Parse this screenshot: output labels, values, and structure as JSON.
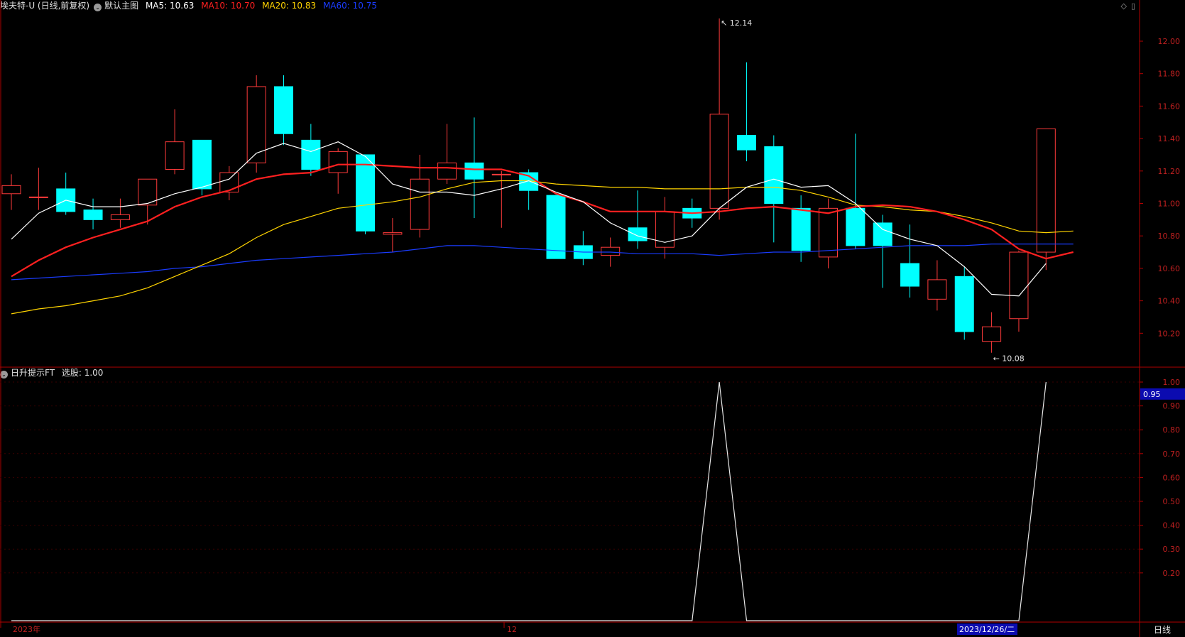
{
  "header": {
    "stock_title": "埃夫特-U (日线,前复权)",
    "main_indicator_label": "默认主图",
    "ma_readouts": [
      {
        "label": "MA5: 10.63",
        "color": "#ffffff"
      },
      {
        "label": "MA10: 10.70",
        "color": "#ff2020"
      },
      {
        "label": "MA20: 10.83",
        "color": "#ffd400"
      },
      {
        "label": "MA60: 10.75",
        "color": "#1a3cff"
      }
    ]
  },
  "indicator_header": {
    "name": "日升提示FT",
    "readout": "选股: 1.00"
  },
  "x_axis": {
    "labels": [
      "2023年",
      "12",
      "2023/12/26/二"
    ],
    "period_label": "日线"
  },
  "annotations": {
    "high_label": "12.14",
    "low_label": "10.08",
    "indicator_crosshair_value": "0.95"
  },
  "colors": {
    "up": "#ff3b3b",
    "down": "#00ffff",
    "axis": "#b00000",
    "ma5": "#ffffff",
    "ma10": "#ff2020",
    "ma20": "#ffd400",
    "ma60": "#1a3cff"
  },
  "chart_data": [
    {
      "type": "candlestick",
      "title": "埃夫特-U (日线,前复权)",
      "y_ticks": [
        10.2,
        10.4,
        10.6,
        10.8,
        11.0,
        11.2,
        11.4,
        11.6,
        11.8,
        12.0
      ],
      "ylim": [
        10.05,
        12.15
      ],
      "candles": [
        {
          "o": 11.06,
          "h": 11.18,
          "l": 10.96,
          "c": 11.11
        },
        {
          "o": 11.04,
          "h": 11.22,
          "l": 10.96,
          "c": 11.04
        },
        {
          "o": 11.09,
          "h": 11.19,
          "l": 10.93,
          "c": 10.95
        },
        {
          "o": 10.96,
          "h": 11.03,
          "l": 10.84,
          "c": 10.9
        },
        {
          "o": 10.9,
          "h": 11.03,
          "l": 10.85,
          "c": 10.93
        },
        {
          "o": 10.99,
          "h": 11.15,
          "l": 10.87,
          "c": 11.15
        },
        {
          "o": 11.21,
          "h": 11.58,
          "l": 11.18,
          "c": 11.38
        },
        {
          "o": 11.39,
          "h": 11.39,
          "l": 11.05,
          "c": 11.09
        },
        {
          "o": 11.07,
          "h": 11.23,
          "l": 11.02,
          "c": 11.19
        },
        {
          "o": 11.25,
          "h": 11.79,
          "l": 11.19,
          "c": 11.72
        },
        {
          "o": 11.72,
          "h": 11.79,
          "l": 11.36,
          "c": 11.43
        },
        {
          "o": 11.39,
          "h": 11.49,
          "l": 11.17,
          "c": 11.21
        },
        {
          "o": 11.19,
          "h": 11.34,
          "l": 11.06,
          "c": 11.32
        },
        {
          "o": 11.3,
          "h": 11.3,
          "l": 10.81,
          "c": 10.83
        },
        {
          "o": 10.81,
          "h": 10.91,
          "l": 10.7,
          "c": 10.82
        },
        {
          "o": 10.84,
          "h": 11.3,
          "l": 10.79,
          "c": 11.15
        },
        {
          "o": 11.15,
          "h": 11.49,
          "l": 11.12,
          "c": 11.25
        },
        {
          "o": 11.25,
          "h": 11.53,
          "l": 10.91,
          "c": 11.15
        },
        {
          "o": 11.18,
          "h": 11.2,
          "l": 10.85,
          "c": 11.18
        },
        {
          "o": 11.19,
          "h": 11.21,
          "l": 10.96,
          "c": 11.08
        },
        {
          "o": 11.05,
          "h": 11.05,
          "l": 10.66,
          "c": 10.66
        },
        {
          "o": 10.74,
          "h": 10.83,
          "l": 10.62,
          "c": 10.66
        },
        {
          "o": 10.68,
          "h": 10.79,
          "l": 10.61,
          "c": 10.73
        },
        {
          "o": 10.85,
          "h": 11.08,
          "l": 10.72,
          "c": 10.77
        },
        {
          "o": 10.73,
          "h": 11.04,
          "l": 10.66,
          "c": 10.95
        },
        {
          "o": 10.97,
          "h": 11.03,
          "l": 10.85,
          "c": 10.91
        },
        {
          "o": 10.97,
          "h": 12.14,
          "l": 10.9,
          "c": 11.55
        },
        {
          "o": 11.42,
          "h": 11.87,
          "l": 11.26,
          "c": 11.33
        },
        {
          "o": 11.35,
          "h": 11.42,
          "l": 10.76,
          "c": 11.0
        },
        {
          "o": 10.97,
          "h": 11.05,
          "l": 10.64,
          "c": 10.71
        },
        {
          "o": 10.67,
          "h": 11.03,
          "l": 10.6,
          "c": 10.97
        },
        {
          "o": 10.97,
          "h": 11.43,
          "l": 10.72,
          "c": 10.74
        },
        {
          "o": 10.88,
          "h": 10.93,
          "l": 10.48,
          "c": 10.74
        },
        {
          "o": 10.63,
          "h": 10.87,
          "l": 10.42,
          "c": 10.49
        },
        {
          "o": 10.41,
          "h": 10.65,
          "l": 10.34,
          "c": 10.53
        },
        {
          "o": 10.55,
          "h": 10.61,
          "l": 10.16,
          "c": 10.21
        },
        {
          "o": 10.15,
          "h": 10.33,
          "l": 10.08,
          "c": 10.24
        },
        {
          "o": 10.29,
          "h": 10.71,
          "l": 10.21,
          "c": 10.7
        },
        {
          "o": 10.7,
          "h": 11.46,
          "l": 10.59,
          "c": 11.46
        }
      ],
      "ma5": [
        10.78,
        10.94,
        11.02,
        10.98,
        10.98,
        11.0,
        11.06,
        11.1,
        11.15,
        11.31,
        11.37,
        11.32,
        11.38,
        11.29,
        11.12,
        11.07,
        11.07,
        11.05,
        11.09,
        11.14,
        11.07,
        11.01,
        10.88,
        10.8,
        10.76,
        10.8,
        10.97,
        11.1,
        11.15,
        11.1,
        11.11,
        11.0,
        10.84,
        10.78,
        10.74,
        10.61,
        10.44,
        10.43,
        10.63
      ],
      "ma10": [
        10.55,
        10.65,
        10.73,
        10.79,
        10.84,
        10.89,
        10.98,
        11.04,
        11.08,
        11.15,
        11.18,
        11.19,
        11.24,
        11.24,
        11.23,
        11.22,
        11.22,
        11.21,
        11.21,
        11.17,
        11.06,
        11.01,
        10.95,
        10.95,
        10.95,
        10.94,
        10.95,
        10.97,
        10.98,
        10.96,
        10.94,
        10.98,
        10.99,
        10.98,
        10.95,
        10.9,
        10.84,
        10.72,
        10.66,
        10.7
      ],
      "ma20": [
        10.32,
        10.35,
        10.37,
        10.4,
        10.43,
        10.48,
        10.55,
        10.62,
        10.69,
        10.79,
        10.87,
        10.92,
        10.97,
        10.99,
        11.01,
        11.04,
        11.09,
        11.13,
        11.14,
        11.14,
        11.12,
        11.11,
        11.1,
        11.1,
        11.09,
        11.09,
        11.09,
        11.1,
        11.1,
        11.08,
        11.04,
        10.99,
        10.98,
        10.96,
        10.95,
        10.92,
        10.88,
        10.83,
        10.82,
        10.83
      ],
      "ma60": [
        10.53,
        10.54,
        10.55,
        10.56,
        10.57,
        10.58,
        10.6,
        10.61,
        10.63,
        10.65,
        10.66,
        10.67,
        10.68,
        10.69,
        10.7,
        10.72,
        10.74,
        10.74,
        10.73,
        10.72,
        10.71,
        10.7,
        10.7,
        10.69,
        10.69,
        10.69,
        10.68,
        10.69,
        10.7,
        10.7,
        10.71,
        10.72,
        10.73,
        10.74,
        10.74,
        10.74,
        10.75,
        10.75,
        10.75,
        10.75
      ]
    },
    {
      "type": "line",
      "title": "日升提示FT",
      "series": [
        {
          "name": "选股",
          "values": [
            0,
            0,
            0,
            0,
            0,
            0,
            0,
            0,
            0,
            0,
            0,
            0,
            0,
            0,
            0,
            0,
            0,
            0,
            0,
            0,
            0,
            0,
            0,
            0,
            0,
            0,
            1,
            0,
            0,
            0,
            0,
            0,
            0,
            0,
            0,
            0,
            0,
            0,
            1
          ]
        }
      ],
      "y_ticks": [
        0.2,
        0.3,
        0.4,
        0.5,
        0.6,
        0.7,
        0.8,
        0.9,
        1.0
      ],
      "ylim": [
        0,
        1
      ]
    }
  ]
}
